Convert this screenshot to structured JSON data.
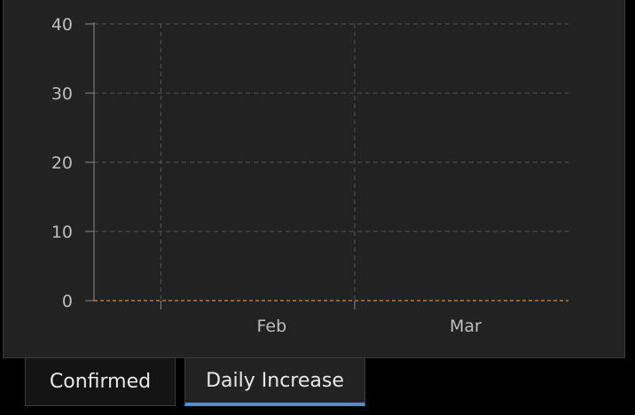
{
  "tabs": [
    {
      "label": "Confirmed",
      "active": false
    },
    {
      "label": "Daily Increase",
      "active": true
    }
  ],
  "colors": {
    "bar": "#ffa62b",
    "background": "#222222",
    "grid": "#555555",
    "tab_indicator": "#4a90d9"
  },
  "chart_data": {
    "type": "bar",
    "y_ticks": [
      0,
      10,
      20,
      30,
      40
    ],
    "ylim": [
      0,
      40
    ],
    "x_tick_labels": [
      {
        "label": "Feb",
        "date": "2020-02-01"
      },
      {
        "label": "Mar",
        "date": "2020-03-01"
      }
    ],
    "grid": true,
    "x_dates": [
      "2020-01-22",
      "2020-01-23",
      "2020-01-24",
      "2020-01-25",
      "2020-01-26",
      "2020-01-27",
      "2020-01-28",
      "2020-01-29",
      "2020-01-30",
      "2020-01-31",
      "2020-02-01",
      "2020-02-02",
      "2020-02-03",
      "2020-02-04",
      "2020-02-05",
      "2020-02-06",
      "2020-02-07",
      "2020-02-08",
      "2020-02-09",
      "2020-02-10",
      "2020-02-11",
      "2020-02-12",
      "2020-02-13",
      "2020-02-14",
      "2020-02-15",
      "2020-02-16",
      "2020-02-17",
      "2020-02-18",
      "2020-02-19",
      "2020-02-20",
      "2020-02-21",
      "2020-02-22",
      "2020-02-23",
      "2020-02-24",
      "2020-02-25",
      "2020-02-26",
      "2020-02-27",
      "2020-02-28",
      "2020-02-29",
      "2020-03-01",
      "2020-03-02",
      "2020-03-03",
      "2020-03-04",
      "2020-03-05",
      "2020-03-06",
      "2020-03-07",
      "2020-03-08",
      "2020-03-09",
      "2020-03-10",
      "2020-03-11",
      "2020-03-12",
      "2020-03-13",
      "2020-03-14",
      "2020-03-15",
      "2020-03-16",
      "2020-03-17",
      "2020-03-18",
      "2020-03-19",
      "2020-03-20",
      "2020-03-21",
      "2020-03-22",
      "2020-03-23",
      "2020-03-24",
      "2020-03-25",
      "2020-03-26",
      "2020-03-27",
      "2020-03-28",
      "2020-03-29",
      "2020-03-30",
      "2020-03-31",
      "2020-04-01"
    ],
    "values": [
      0,
      0,
      0,
      0,
      0,
      0,
      0,
      0,
      0,
      0,
      0,
      0,
      0,
      0,
      0,
      0,
      0,
      0,
      0,
      0,
      0,
      0,
      0,
      0,
      0,
      0,
      0,
      0,
      0,
      0,
      0,
      0,
      0,
      0,
      0,
      0,
      0,
      0,
      0,
      0,
      0,
      0,
      0,
      0,
      0,
      0,
      0,
      0,
      0,
      0,
      0,
      0,
      0,
      0,
      0,
      0,
      0,
      0,
      0,
      0,
      0,
      0,
      0,
      0,
      0,
      0,
      0,
      0,
      0,
      0,
      0
    ]
  }
}
